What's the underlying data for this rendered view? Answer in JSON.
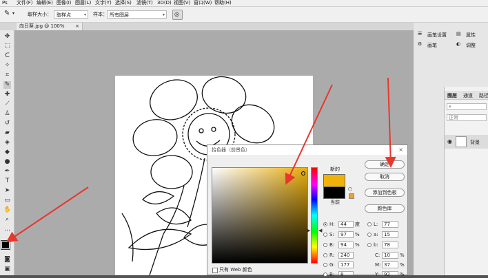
{
  "menu": [
    "文件(F)",
    "编辑(E)",
    "图像(I)",
    "图层(L)",
    "文字(Y)",
    "选择(S)",
    "滤镜(T)",
    "3D(D)",
    "视图(V)",
    "窗口(W)",
    "帮助(H)"
  ],
  "options": {
    "sample_size_label": "取样大小：",
    "sample_size_value": "取样点",
    "sample_label": "样本：",
    "sample_value": "所有图层"
  },
  "document": {
    "tab_title": "向日葵.jpg @ 100%(RGB/8)",
    "tab_close": "×"
  },
  "panels": {
    "brush_settings": "画笔设置",
    "brushes": "画笔",
    "properties": "属性",
    "adjustments": "调整",
    "layers_tab": "图层",
    "channels_tab": "通道",
    "paths_tab": "路径",
    "blend_mode": "正常",
    "layer_name": "背景"
  },
  "picker": {
    "title": "拾色器（前景色）",
    "new_label": "新的",
    "current_label": "当前",
    "buttons": {
      "ok": "确定",
      "cancel": "取消",
      "add_swatch": "添加到色板",
      "libraries": "颜色库"
    },
    "web_only_label": "只有 Web 颜色",
    "fields": {
      "H": {
        "label": "H:",
        "value": "44",
        "unit": "度"
      },
      "S": {
        "label": "S:",
        "value": "97",
        "unit": "%"
      },
      "B": {
        "label": "B:",
        "value": "94",
        "unit": "%"
      },
      "R": {
        "label": "R:",
        "value": "240"
      },
      "G": {
        "label": "G:",
        "value": "177"
      },
      "Bl": {
        "label": "B:",
        "value": "8"
      },
      "L": {
        "label": "L:",
        "value": "77"
      },
      "a": {
        "label": "a:",
        "value": "15"
      },
      "b": {
        "label": "b:",
        "value": "78"
      },
      "C": {
        "label": "C:",
        "value": "10",
        "unit": "%"
      },
      "M": {
        "label": "M:",
        "value": "37",
        "unit": "%"
      },
      "Y": {
        "label": "Y:",
        "value": "92",
        "unit": "%"
      }
    },
    "new_color": "#f0b108",
    "current_color": "#000000"
  },
  "colors": {
    "accent_arrow": "#e8372c"
  }
}
